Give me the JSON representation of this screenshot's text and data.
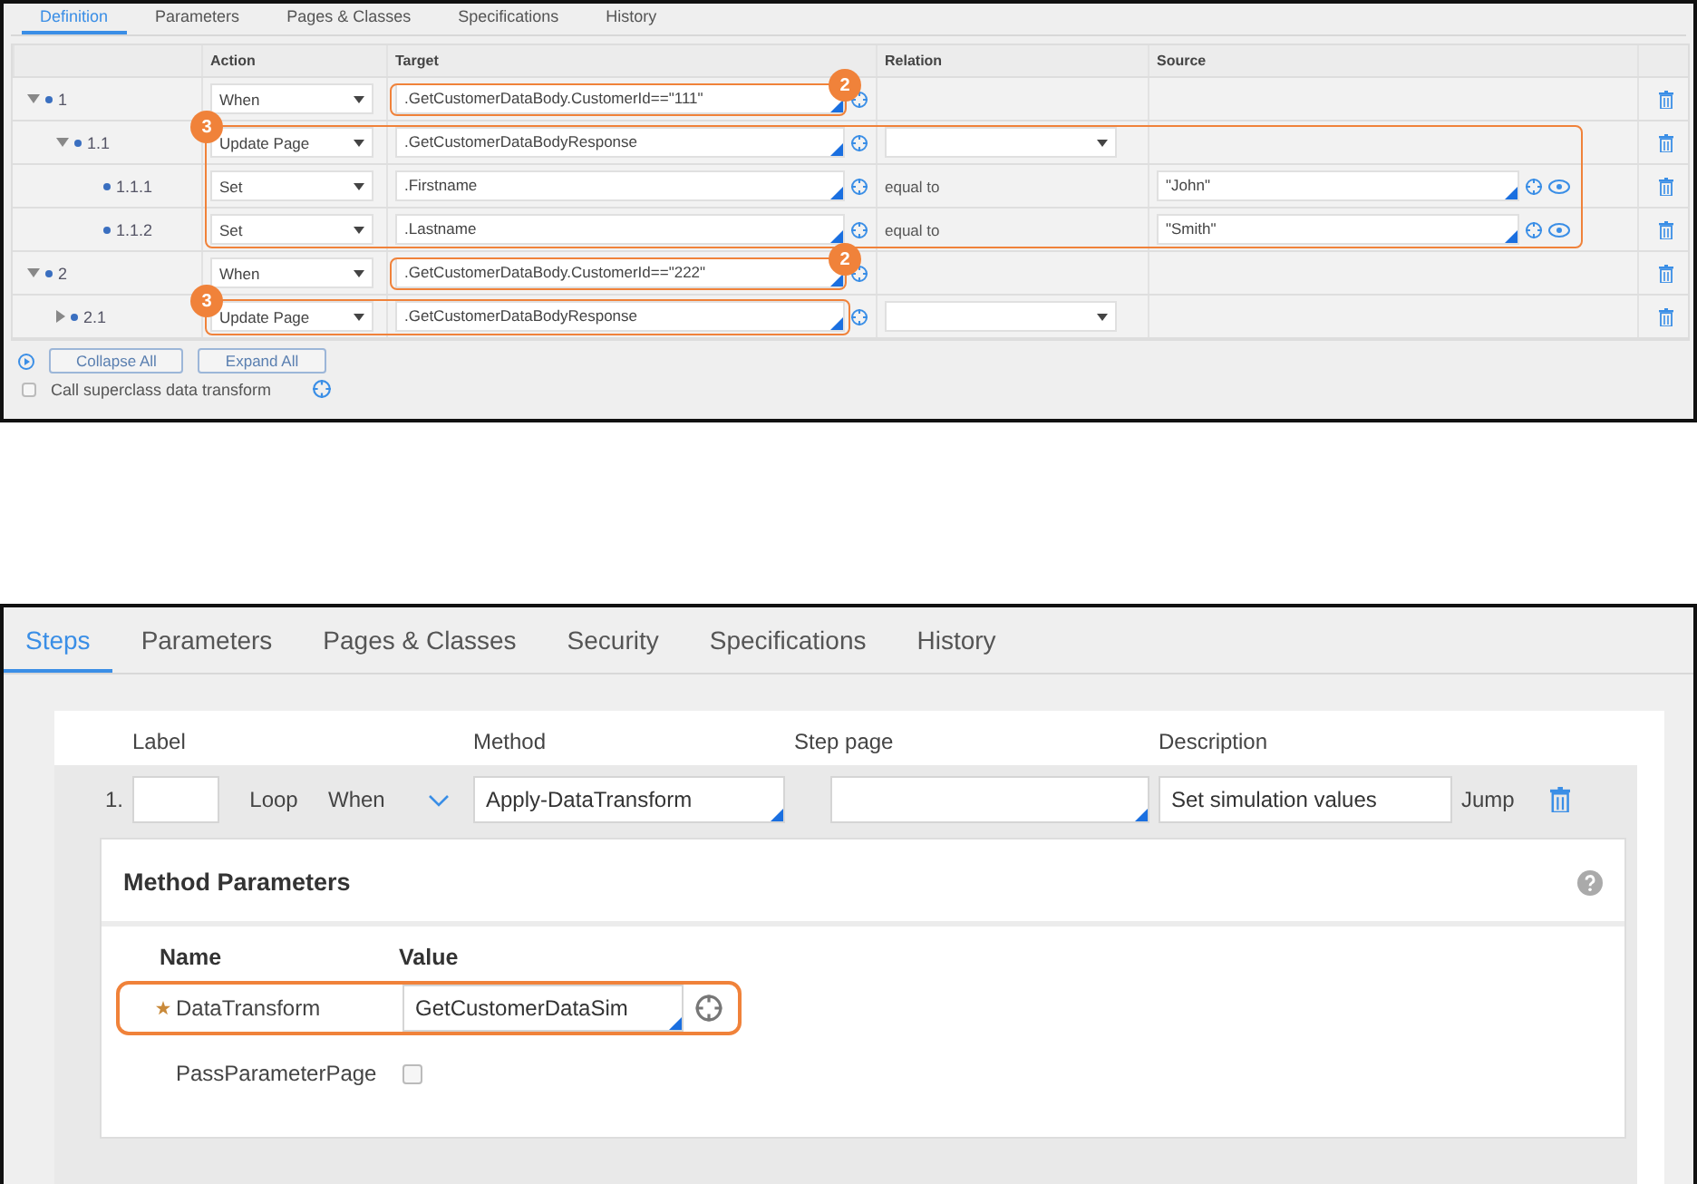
{
  "definition_panel": {
    "tabs": [
      {
        "label": "Definition",
        "selected": true
      },
      {
        "label": "Parameters",
        "selected": false
      },
      {
        "label": "Pages & Classes",
        "selected": false
      },
      {
        "label": "Specifications",
        "selected": false
      },
      {
        "label": "History",
        "selected": false
      }
    ],
    "columns": [
      "Action",
      "Target",
      "Relation",
      "Source"
    ],
    "rows": [
      {
        "number": "1",
        "expanded": true,
        "action": "When",
        "target": ".GetCustomerDataBody.CustomerId==\"111\"",
        "callout": {
          "label": "2",
          "kind": "cell"
        },
        "children": [
          {
            "number": "1.1",
            "expanded": true,
            "action": "Update Page",
            "target": ".GetCustomerDataBodyResponse",
            "relation": {
              "kind": "select"
            },
            "callout": {
              "label": "3",
              "kind": "block"
            },
            "children": [
              {
                "number": "1.1.1",
                "action": "Set",
                "target": ".Firstname",
                "relation": {
                  "kind": "text",
                  "value": "equal to"
                },
                "source": "\"John\""
              },
              {
                "number": "1.1.2",
                "action": "Set",
                "target": ".Lastname",
                "relation": {
                  "kind": "text",
                  "value": "equal to"
                },
                "source": "\"Smith\""
              }
            ]
          }
        ]
      },
      {
        "number": "2",
        "expanded": true,
        "action": "When",
        "target": ".GetCustomerDataBody.CustomerId==\"222\"",
        "callout": {
          "label": "2",
          "kind": "cell"
        },
        "children": [
          {
            "number": "2.1",
            "expanded": false,
            "action": "Update Page",
            "target": ".GetCustomerDataBodyResponse",
            "relation": {
              "kind": "select"
            },
            "callout": {
              "label": "3",
              "kind": "row"
            }
          }
        ]
      }
    ],
    "buttons": [
      "Collapse All",
      "Expand All"
    ],
    "superclass": {
      "label": "Call superclass data transform",
      "checked": false
    }
  },
  "steps_panel": {
    "tabs": [
      {
        "label": "Steps",
        "selected": true
      },
      {
        "label": "Parameters",
        "selected": false
      },
      {
        "label": "Pages & Classes",
        "selected": false
      },
      {
        "label": "Security",
        "selected": false
      },
      {
        "label": "Specifications",
        "selected": false
      },
      {
        "label": "History",
        "selected": false
      }
    ],
    "headers": {
      "label": "Label",
      "method": "Method",
      "step_page": "Step page",
      "description": "Description"
    },
    "step": {
      "number": "1.",
      "loop": "Loop",
      "when": "When",
      "method": "Apply-DataTransform",
      "description": "Set simulation values",
      "jump": "Jump"
    },
    "method_parameters": {
      "title": "Method Parameters",
      "name_header": "Name",
      "value_header": "Value",
      "params": [
        {
          "kind": "field",
          "name": "DataTransform",
          "required": true,
          "value": "GetCustomerDataSim",
          "highlighted": true
        },
        {
          "kind": "checkbox",
          "name": "PassParameterPage",
          "required": false,
          "checked": false,
          "highlighted": false
        }
      ]
    }
  }
}
